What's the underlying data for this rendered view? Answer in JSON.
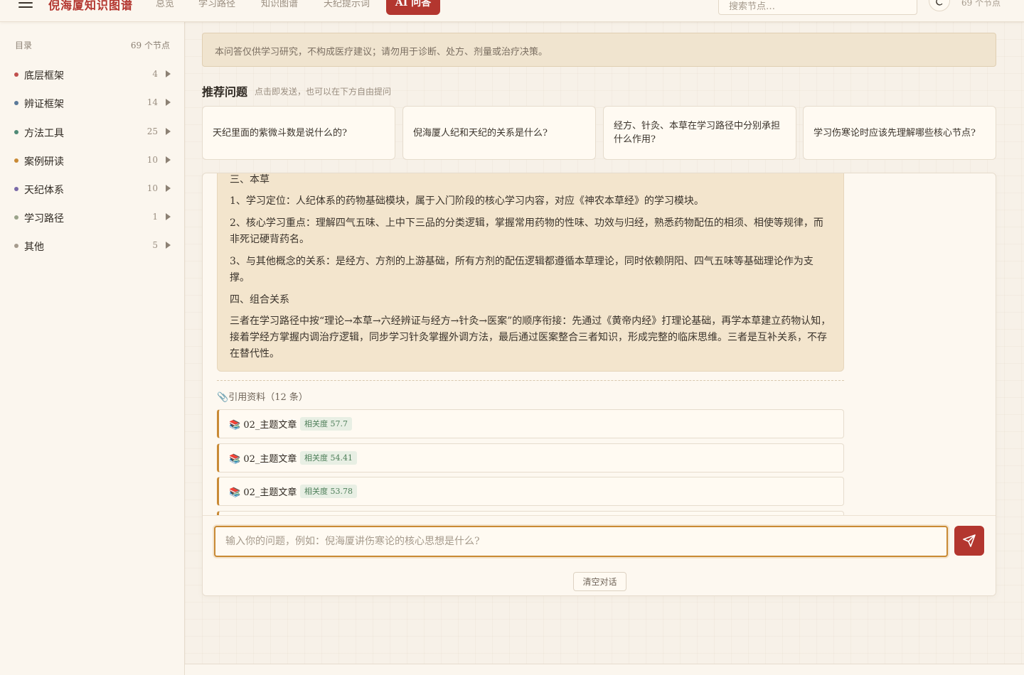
{
  "topbar": {
    "brand": "倪海厦知识图谱",
    "nav": [
      "总览",
      "学习路径",
      "知识图谱",
      "天纪提示词"
    ],
    "active_nav": "AI 问答",
    "search_placeholder": "搜索节点…",
    "node_count": "69 个节点"
  },
  "sidebar": {
    "title": "目录",
    "count": "69 个节点",
    "items": [
      {
        "label": "底层框架",
        "count": "4",
        "color": "#c0504d"
      },
      {
        "label": "辨证框架",
        "count": "14",
        "color": "#5b7a99"
      },
      {
        "label": "方法工具",
        "count": "25",
        "color": "#4f8a76"
      },
      {
        "label": "案例研读",
        "count": "10",
        "color": "#c98a35"
      },
      {
        "label": "天纪体系",
        "count": "10",
        "color": "#7a6aa8"
      },
      {
        "label": "学习路径",
        "count": "1",
        "color": "#9aa38a"
      },
      {
        "label": "其他",
        "count": "5",
        "color": "#a59a8c"
      }
    ]
  },
  "main": {
    "disclaimer": "本问答仅供学习研究，不构成医疗建议；请勿用于诊断、处方、剂量或治疗决策。",
    "recommend": {
      "title": "推荐问题",
      "hint": "点击即发送，也可以在下方自由提问",
      "cards": [
        "天纪里面的紫微斗数是说什么的?",
        "倪海厦人纪和天纪的关系是什么?",
        "经方、针灸、本草在学习路径中分别承担什么作用?",
        "学习伤寒论时应该先理解哪些核心节点?"
      ]
    },
    "answer": {
      "paragraphs": [
        "三、本草",
        "1、学习定位：人纪体系的药物基础模块，属于入门阶段的核心学习内容，对应《神农本草经》的学习模块。",
        "2、核心学习重点：理解四气五味、上中下三品的分类逻辑，掌握常用药物的性味、功效与归经，熟悉药物配伍的相须、相使等规律，而非死记硬背药名。",
        "3、与其他概念的关系：是经方、方剂的上游基础，所有方剂的配伍逻辑都遵循本草理论，同时依赖阴阳、四气五味等基础理论作为支撑。",
        "四、组合关系",
        "三者在学习路径中按“理论→本草→六经辨证与经方→针灸→医案”的顺序衔接：先通过《黄帝内经》打理论基础，再学本草建立药物认知，接着学经方掌握内调治疗逻辑，同步学习针灸掌握外调方法，最后通过医案整合三者知识，形成完整的临床思维。三者是互补关系，不存在替代性。"
      ]
    },
    "refs": {
      "title": "引用资料（12 条）",
      "items": [
        {
          "title": "02_主题文章",
          "relevance": "相关度 57.7"
        },
        {
          "title": "02_主题文章",
          "relevance": "相关度 54.41"
        },
        {
          "title": "02_主题文章",
          "relevance": "相关度 53.78"
        }
      ]
    },
    "input_placeholder": "输入你的问题，例如：倪海厦讲伤寒论的核心思想是什么?",
    "clear_label": "清空对话"
  },
  "colors": {
    "accent": "#b3362f",
    "focus": "#c98a35",
    "background": "#f7f1e8"
  }
}
